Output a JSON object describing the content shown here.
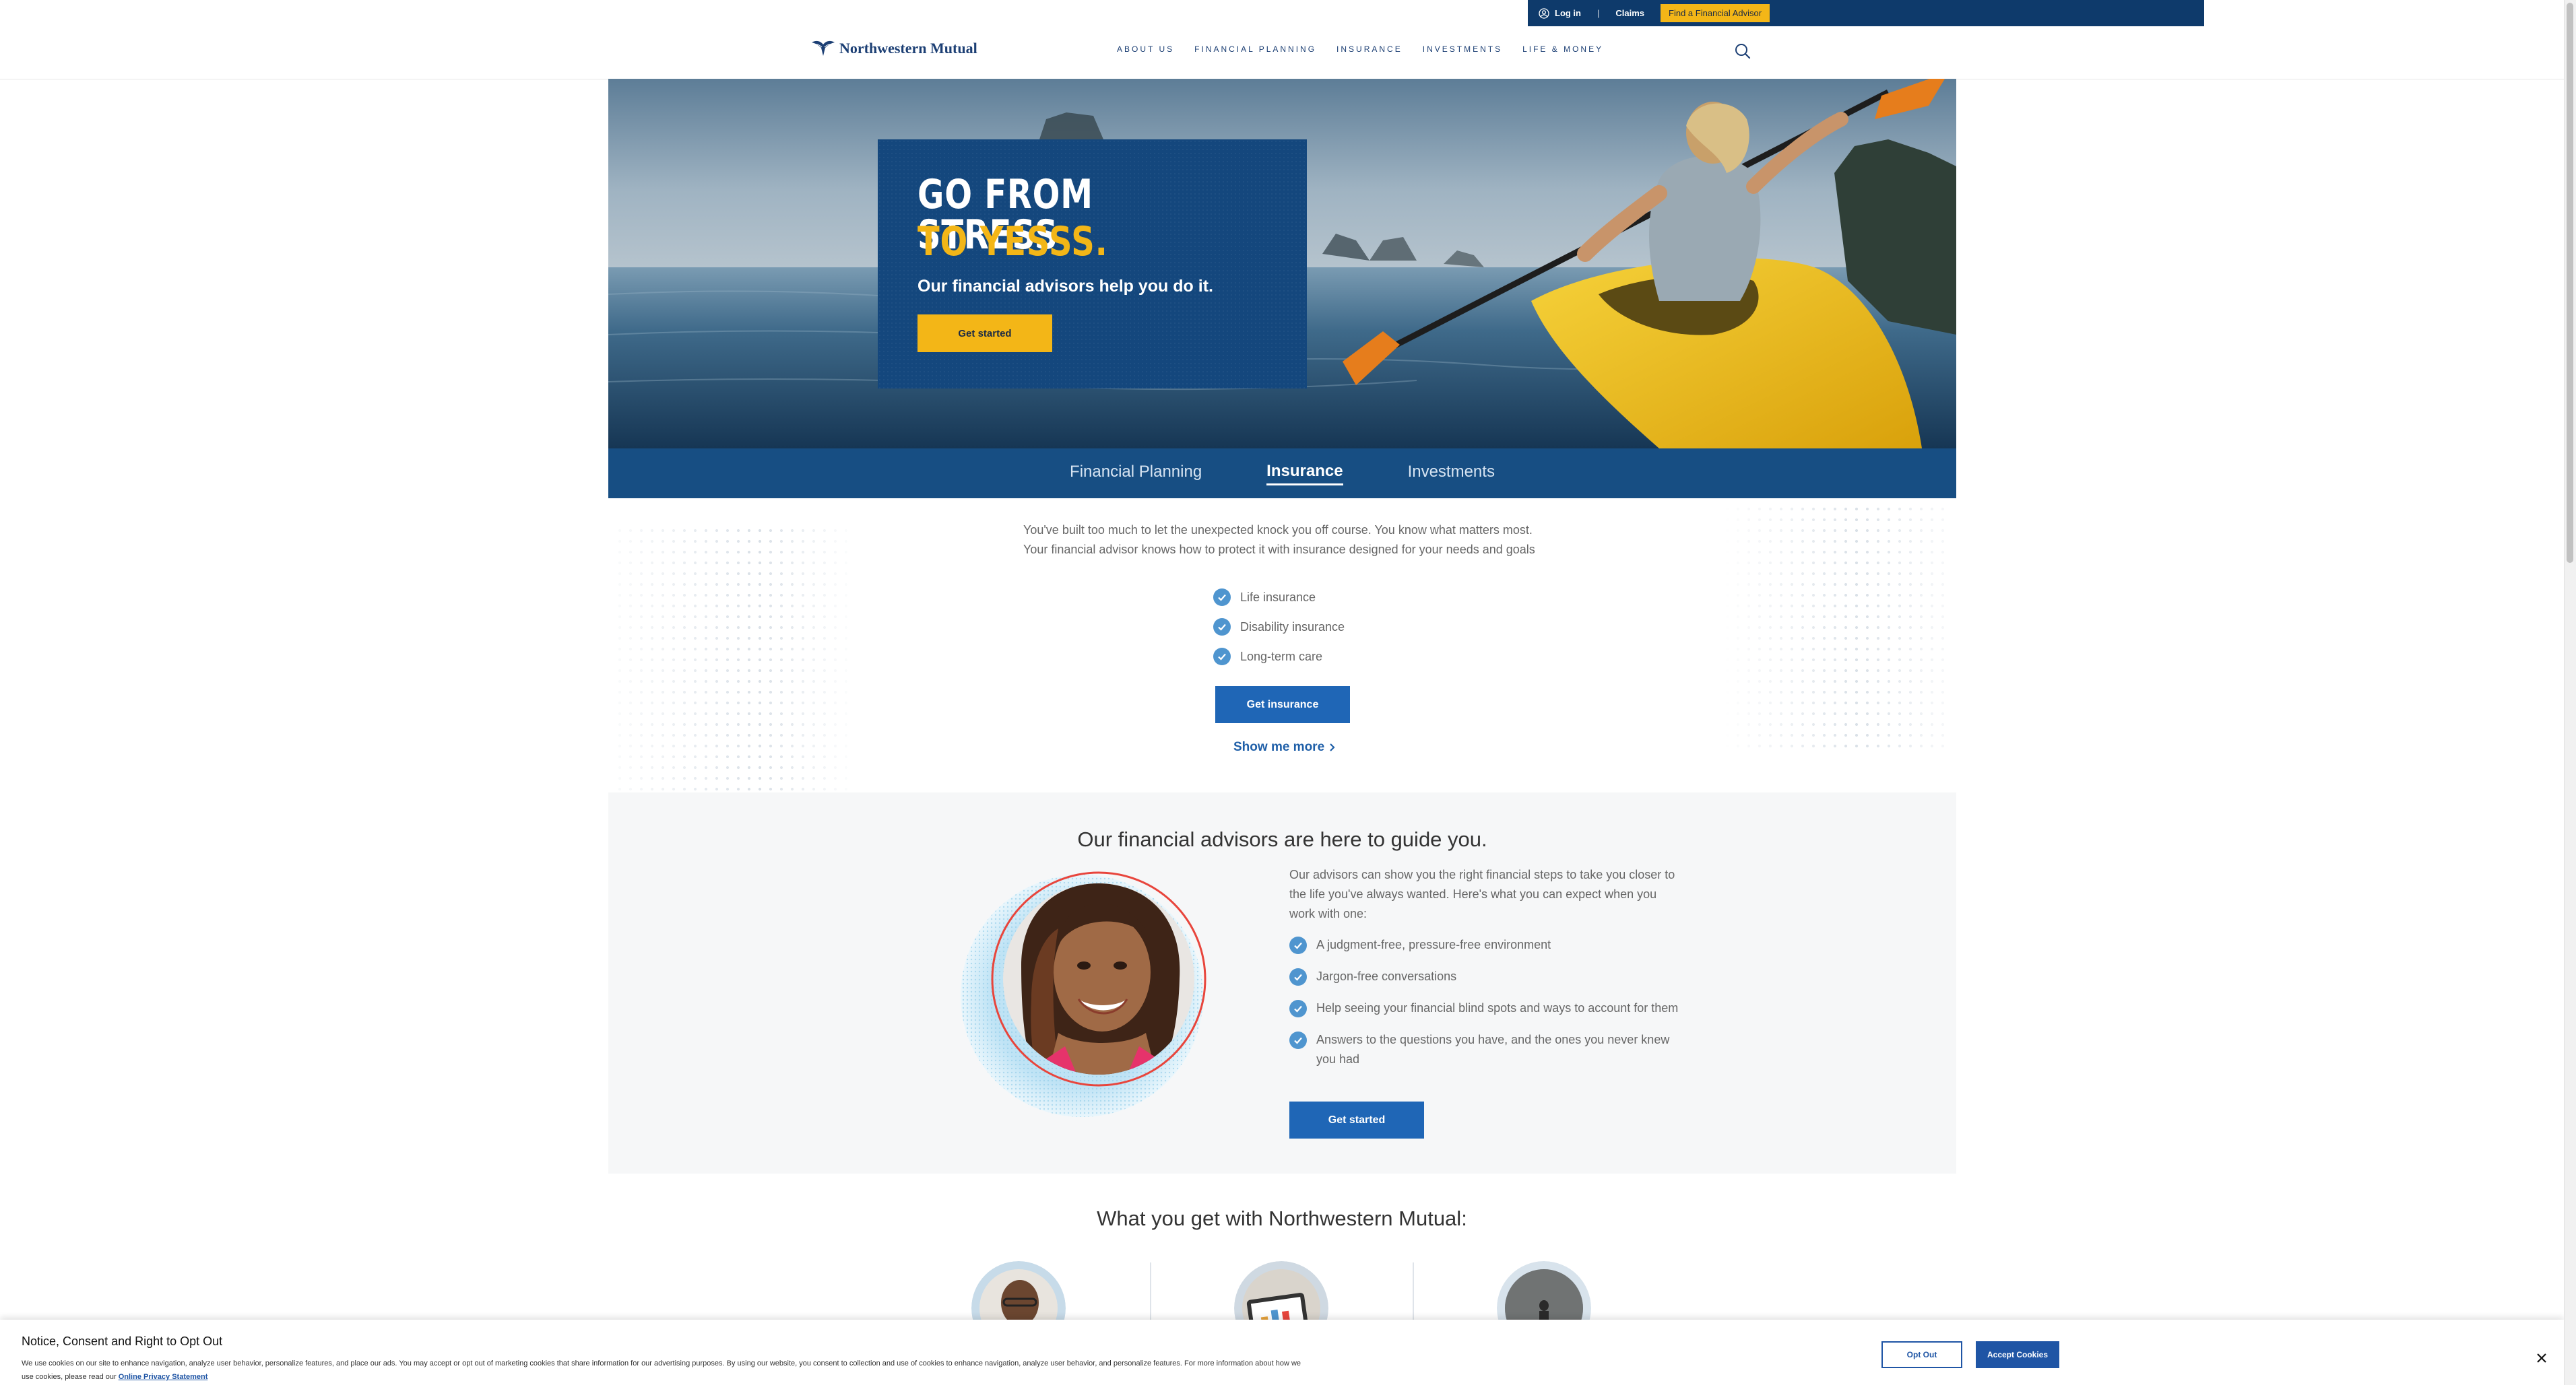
{
  "utility": {
    "login": "Log in",
    "separator": "|",
    "claims": "Claims",
    "find_advisor": "Find a Financial Advisor"
  },
  "header": {
    "logo_text": "Northwestern Mutual",
    "nav": [
      "ABOUT US",
      "FINANCIAL PLANNING",
      "INSURANCE",
      "INVESTMENTS",
      "LIFE & MONEY"
    ]
  },
  "hero": {
    "line1": "GO FROM STRESS",
    "line2": "TO YESSS.",
    "subtitle": "Our financial advisors help you do it.",
    "cta": "Get started"
  },
  "tabs": [
    {
      "label": "Financial Planning",
      "active": false
    },
    {
      "label": "Insurance",
      "active": true
    },
    {
      "label": "Investments",
      "active": false
    }
  ],
  "insurance": {
    "intro": "You've built too much to let the unexpected knock you off course. You know what matters most. Your financial advisor knows how to protect it with insurance designed for your needs and goals",
    "items": [
      "Life insurance",
      "Disability insurance",
      "Long-term care"
    ],
    "cta": "Get insurance",
    "show_more": "Show me more"
  },
  "advisors": {
    "title": "Our financial advisors are here to guide you.",
    "intro": "Our advisors can show you the right financial steps to take you closer to the life you've always wanted. Here's what you can expect when you work with one:",
    "items": [
      "A judgment-free, pressure-free environment",
      "Jargon-free conversations",
      "Help seeing your financial blind spots and ways to account for them",
      "Answers to the questions you have, and the ones you never knew you had"
    ],
    "cta": "Get started"
  },
  "what_you_get": {
    "title": "What you get with Northwestern Mutual:"
  },
  "cookie": {
    "title": "Notice, Consent and Right to Opt Out",
    "body_line1": "We use cookies on our site to enhance navigation, analyze user behavior, personalize features, and place our ads. You may accept or opt out of marketing cookies that share information for our advertising purposes. By using our website, you consent to collection and use of cookies to enhance navigation, analyze user behavior, and personalize features. For more information about how we",
    "body_line2": "use cookies, please read our",
    "link": "Online Privacy Statement",
    "opt_out": "Opt Out",
    "accept": "Accept Cookies",
    "close": "×"
  },
  "colors": {
    "navy": "#0e3a6b",
    "brand_blue": "#1c3f74",
    "gold": "#f3b617",
    "button_blue": "#1f66b6",
    "check_blue": "#4f95cf"
  }
}
